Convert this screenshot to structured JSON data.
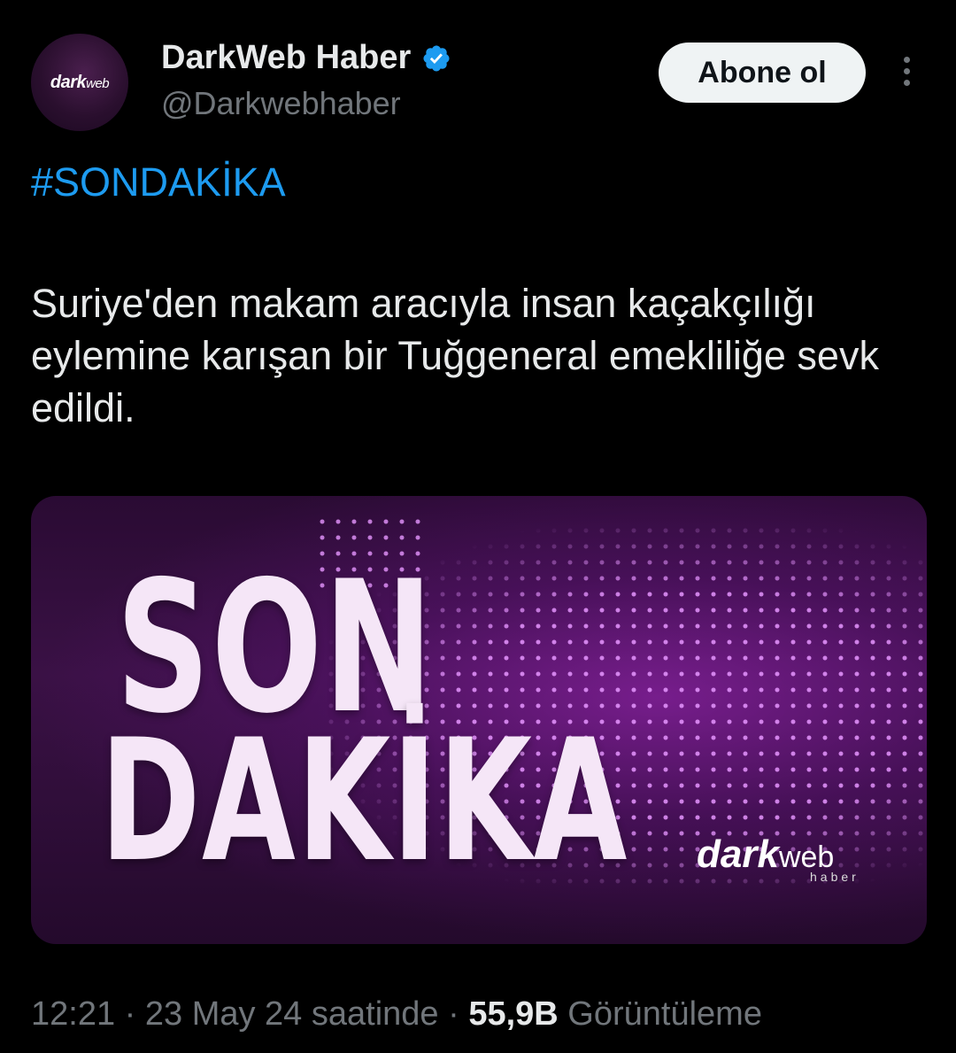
{
  "account": {
    "display_name": "DarkWeb Haber",
    "handle": "@Darkwebhaber",
    "avatar_logo_text": "dark",
    "avatar_logo_suffix": "web",
    "verified_color": "#1d9bf0"
  },
  "follow_button": {
    "label": "Abone ol"
  },
  "tweet": {
    "hashtag": "#SONDAKİKA",
    "text": "Suriye'den makam aracıyla insan kaçakçılığı eylemine karışan bir Tuğgeneral emekliliğe sevk edildi."
  },
  "media": {
    "headline_line1": "SON",
    "headline_line2": "DAKİKA",
    "logo_main": "dark",
    "logo_suffix": "web",
    "logo_sub": "haber"
  },
  "meta": {
    "time": "12:21",
    "date_text": "23 May 24 saatinde",
    "views_count": "55,9B",
    "views_label": "Görüntüleme",
    "separator": "·"
  },
  "colors": {
    "background": "#000000",
    "text": "#e7e9ea",
    "muted": "#71767b",
    "accent": "#1d9bf0"
  }
}
